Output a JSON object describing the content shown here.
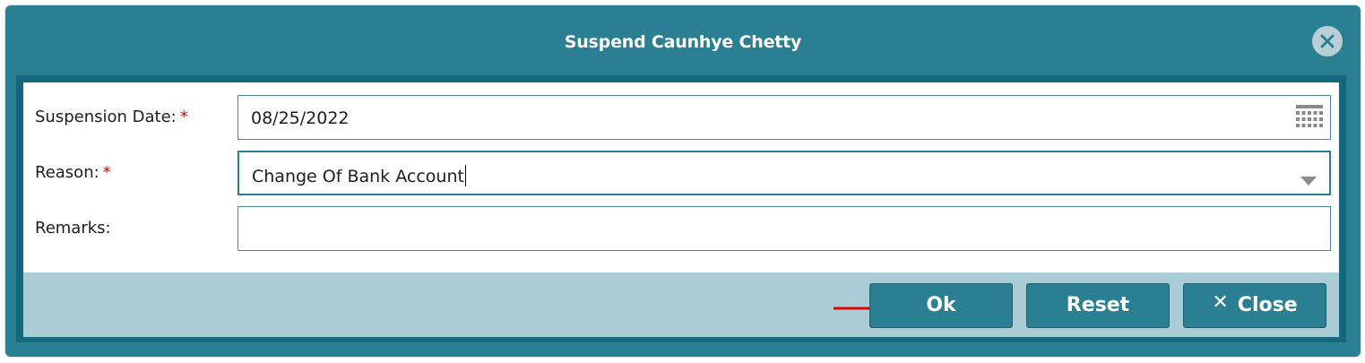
{
  "dialog": {
    "title": "Suspend Caunhye Chetty",
    "close_icon": "close-circle-icon"
  },
  "form": {
    "suspension_date": {
      "label": "Suspension Date:",
      "required_mark": "*",
      "value": "08/25/2022",
      "icon": "calendar-icon"
    },
    "reason": {
      "label": "Reason:",
      "required_mark": "*",
      "value": "Change Of Bank Account",
      "icon": "dropdown-caret-icon"
    },
    "remarks": {
      "label": "Remarks:",
      "value": ""
    }
  },
  "footer": {
    "ok_label": "Ok",
    "reset_label": "Reset",
    "close_label": "Close",
    "close_icon": "x-icon"
  },
  "annotation": {
    "arrow_color": "#e00000",
    "points_to": "ok-button"
  },
  "colors": {
    "header": "#2b7f92",
    "frame": "#15677b",
    "footer": "#a9ccd5",
    "required": "#e00000"
  }
}
